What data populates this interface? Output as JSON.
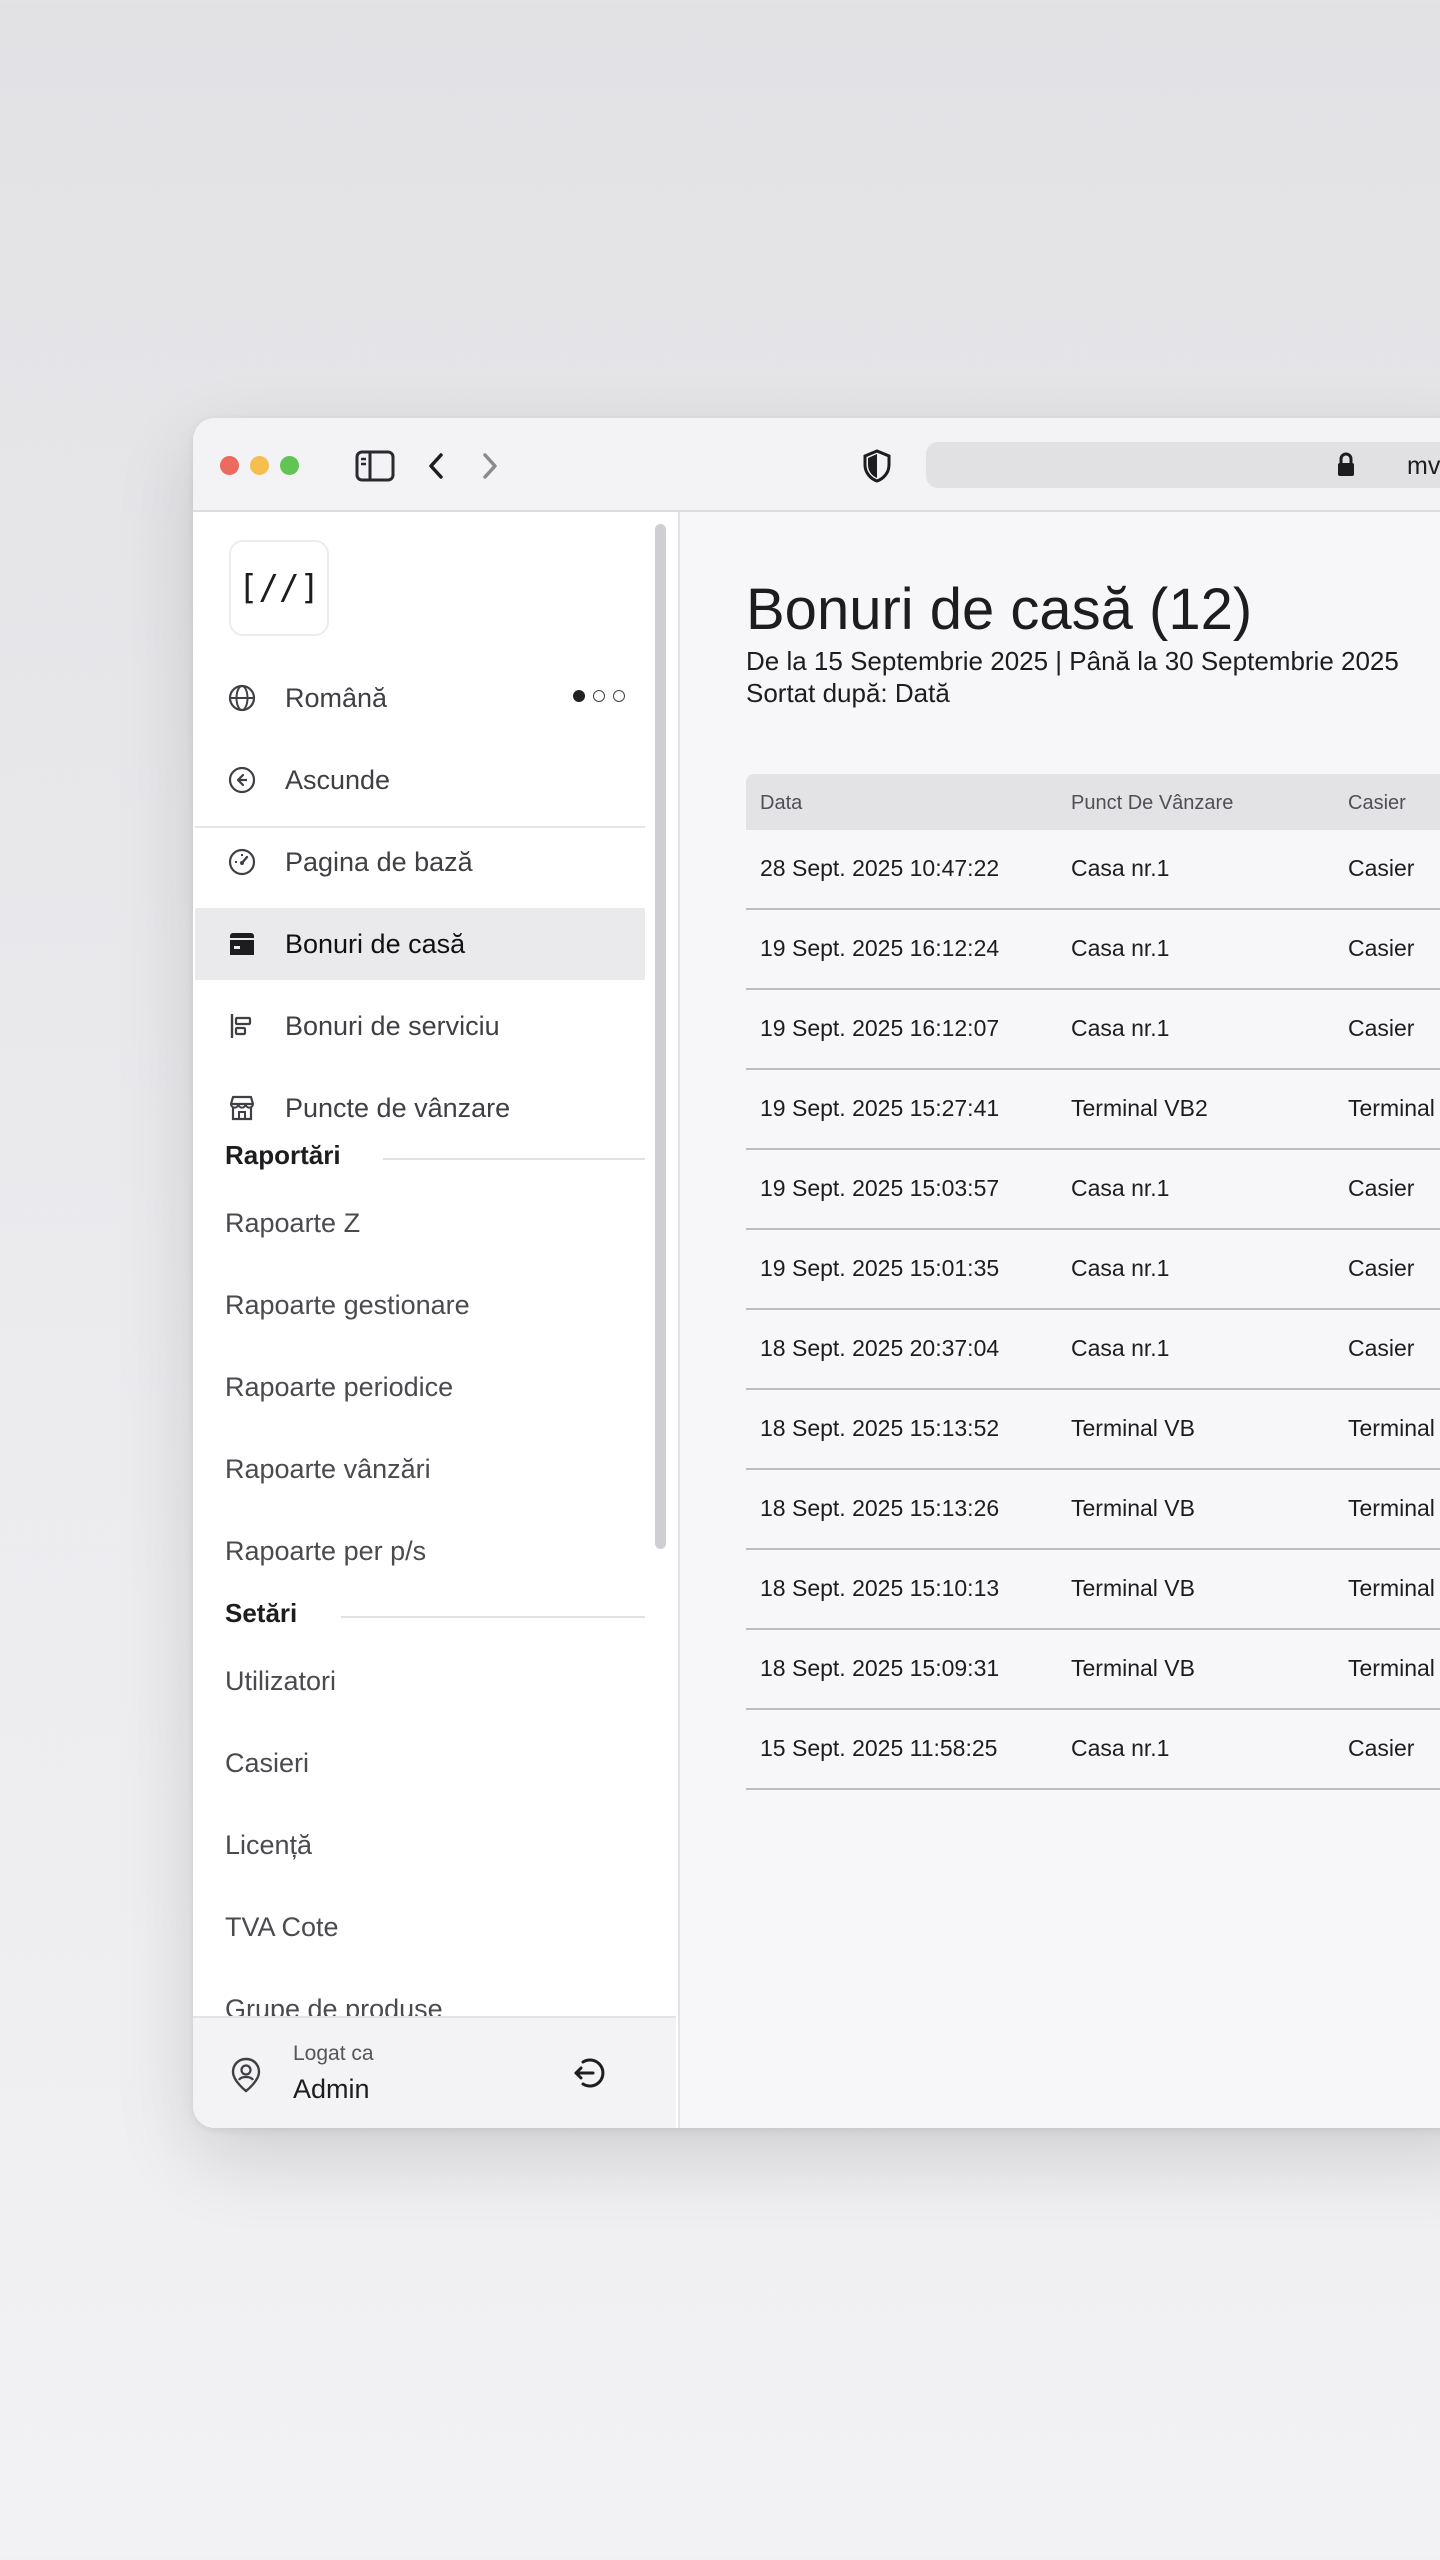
{
  "browser": {
    "url": "mv",
    "colors": {
      "close": "#ec6a5e",
      "minimize": "#f4bf4f",
      "zoom": "#61c554"
    }
  },
  "sidebar": {
    "logo_text": "[//]",
    "language": {
      "label": "Română",
      "pages": 3,
      "current_page": 1
    },
    "hide_label": "Ascunde",
    "nav": [
      {
        "label": "Pagina de bază",
        "icon": "dashboard-gauge-icon",
        "active": false
      },
      {
        "label": "Bonuri de casă",
        "icon": "receipt-icon",
        "active": true
      },
      {
        "label": "Bonuri de serviciu",
        "icon": "service-receipt-icon",
        "active": false
      },
      {
        "label": "Puncte de vânzare",
        "icon": "store-icon",
        "active": false
      }
    ],
    "sections": [
      {
        "title": "Raportări",
        "items": [
          "Rapoarte Z",
          "Rapoarte gestionare",
          "Rapoarte periodice",
          "Rapoarte vânzări",
          "Rapoarte per p/s"
        ]
      },
      {
        "title": "Setări",
        "items": [
          "Utilizatori",
          "Casieri",
          "Licență",
          "TVA Cote",
          "Grupe de produse"
        ]
      }
    ],
    "footer": {
      "caption": "Logat ca",
      "user": "Admin"
    }
  },
  "main": {
    "title": "Bonuri de casă (12)",
    "range": "De la 15 Septembrie 2025 | Până la 30 Septembrie 2025",
    "sort": "Sortat după: Dată",
    "table": {
      "columns": [
        "Data",
        "Punct De Vânzare",
        "Casier"
      ],
      "rows": [
        [
          "28 Sept. 2025 10:47:22",
          "Casa nr.1",
          "Casier"
        ],
        [
          "19 Sept. 2025 16:12:24",
          "Casa nr.1",
          "Casier"
        ],
        [
          "19 Sept. 2025 16:12:07",
          "Casa nr.1",
          "Casier"
        ],
        [
          "19 Sept. 2025 15:27:41",
          "Terminal VB2",
          "Terminal"
        ],
        [
          "19 Sept. 2025 15:03:57",
          "Casa nr.1",
          "Casier"
        ],
        [
          "19 Sept. 2025 15:01:35",
          "Casa nr.1",
          "Casier"
        ],
        [
          "18 Sept. 2025 20:37:04",
          "Casa nr.1",
          "Casier"
        ],
        [
          "18 Sept. 2025 15:13:52",
          "Terminal VB",
          "Terminal"
        ],
        [
          "18 Sept. 2025 15:13:26",
          "Terminal VB",
          "Terminal"
        ],
        [
          "18 Sept. 2025 15:10:13",
          "Terminal VB",
          "Terminal"
        ],
        [
          "18 Sept. 2025 15:09:31",
          "Terminal VB",
          "Terminal"
        ],
        [
          "15 Sept. 2025 11:58:25",
          "Casa nr.1",
          "Casier"
        ]
      ]
    }
  }
}
